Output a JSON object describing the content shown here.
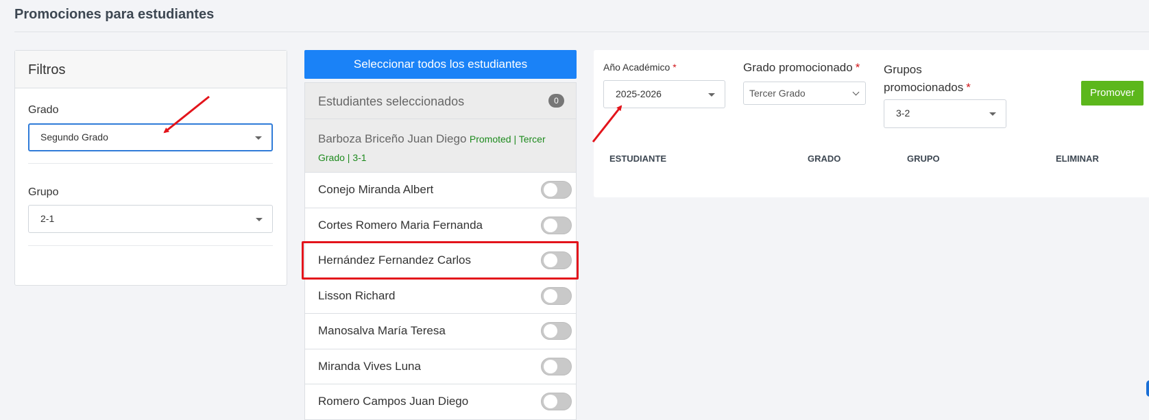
{
  "page": {
    "title": "Promociones para estudiantes"
  },
  "filters": {
    "heading": "Filtros",
    "grado": {
      "label": "Grado",
      "value": "Segundo Grado"
    },
    "grupo": {
      "label": "Grupo",
      "value": "2-1"
    }
  },
  "students": {
    "select_all_label": "Seleccionar todos los estudiantes",
    "selected_header": "Estudiantes seleccionados",
    "selected_count": "0",
    "promoted": {
      "name": "Barboza Briceño Juan Diego",
      "tag": "Promoted | Tercer Grado | 3-1"
    },
    "list": [
      {
        "name": "Conejo Miranda Albert"
      },
      {
        "name": "Cortes Romero Maria Fernanda"
      },
      {
        "name": "Hernández Fernandez Carlos"
      },
      {
        "name": "Lisson Richard"
      },
      {
        "name": "Manosalva María Teresa"
      },
      {
        "name": "Miranda Vives Luna"
      },
      {
        "name": "Romero Campos Juan Diego"
      }
    ]
  },
  "promotion": {
    "academic_year": {
      "label": "Año Académico",
      "required": "*",
      "value": "2025-2026"
    },
    "promoted_grade": {
      "label": "Grado promocionado",
      "required": "*",
      "value": "Tercer Grado"
    },
    "promoted_groups": {
      "label_line1": "Grupos",
      "label_line2": "promocionados",
      "required": "*",
      "value": "3-2"
    },
    "promote_button": "Promover",
    "table_headers": {
      "student": "ESTUDIANTE",
      "grade": "GRADO",
      "group": "GRUPO",
      "delete": "ELIMINAR"
    }
  },
  "colors": {
    "primary": "#1a82f7",
    "success": "#5cb71c",
    "promoted_text": "#1d8a1d",
    "annotation": "#e3141b"
  }
}
